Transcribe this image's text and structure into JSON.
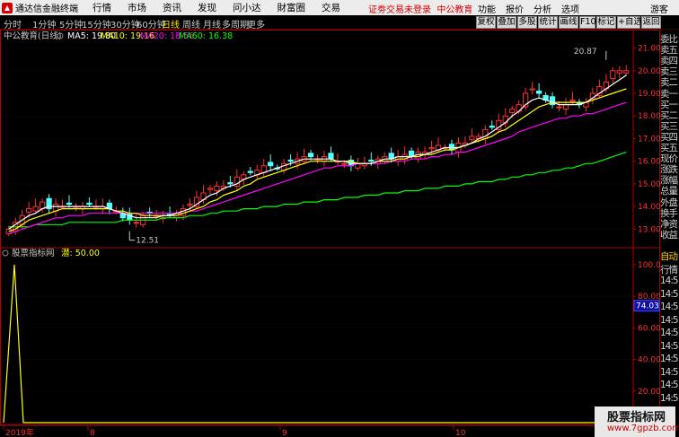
{
  "menubar": {
    "app_name": "通达信金融终端",
    "items": [
      "行情",
      "市场",
      "资讯",
      "发现",
      "问小达",
      "財富圈",
      "交易"
    ],
    "notice": "证劵交易未登录",
    "stock": "中公教育",
    "right_items": [
      "功能",
      "报价",
      "分析",
      "选项"
    ],
    "user": "游客"
  },
  "toolbar": {
    "periods": [
      "分时",
      "1分钟",
      "5分钟",
      "15分钟",
      "30分钟",
      "60分钟",
      "日线",
      "周线",
      "月线",
      "多周期",
      "更多"
    ],
    "active_period": "日线",
    "tools": [
      "复权",
      "叠加",
      "多股",
      "统计",
      "画线",
      "F10",
      "标记",
      "+自选",
      "返回"
    ]
  },
  "price_panel": {
    "title": "中公教育(日线)",
    "ma_items": [
      {
        "label": "MA5: 19.80",
        "color": "#ffffff"
      },
      {
        "label": "MA10: 19.16",
        "color": "#ffff00"
      },
      {
        "label": "MA20: 18.56",
        "color": "#ff00ff"
      },
      {
        "label": "MA60: 16.38",
        "color": "#00ff00"
      }
    ],
    "high_annotation": "20.87",
    "low_annotation": "12.51",
    "y_ticks": [
      "21.00",
      "20.00",
      "19.00",
      "18.00",
      "17.00",
      "16.00",
      "15.00",
      "14.00",
      "13.00"
    ]
  },
  "indicator_panel": {
    "title": "股票指标网",
    "label": "潜: 50.00",
    "y_ticks": [
      "100.0",
      "80.00",
      "60.00",
      "40.00",
      "20.00",
      "0.00"
    ],
    "current_value": "74.03"
  },
  "x_axis": {
    "labels": [
      "2019年",
      "8",
      "9",
      "10"
    ]
  },
  "sidepanel": {
    "labels": [
      "委比",
      "卖五",
      "卖四",
      "卖三",
      "卖二",
      "卖一",
      "买一",
      "买二",
      "买三",
      "买四",
      "买五",
      "现价",
      "涨跌",
      "涨幅",
      "总量",
      "外盘",
      "换手",
      "净资",
      "收益"
    ],
    "labels2": [
      "自动",
      "行情",
      "14:5",
      "14:5",
      "14:5",
      "14:5",
      "14:5",
      "14:5",
      "14:5",
      "14:5",
      "14:5",
      "14:5"
    ]
  },
  "watermark": {
    "title": "股票指标网",
    "url": "www.7gpzb.com"
  },
  "colors": {
    "up": "#ff3030",
    "down": "#54ffff",
    "ma5": "#ffffff",
    "ma10": "#ffff00",
    "ma20": "#ff00ff",
    "ma60": "#00ff00",
    "frame": "#b00000",
    "axis_text": "#ff3030"
  },
  "chart_data": {
    "type": "line",
    "y_range_price": [
      12.3,
      21.3
    ],
    "candles_close": [
      13.0,
      13.3,
      13.6,
      13.9,
      14.0,
      14.2,
      13.9,
      14.1,
      14.0,
      14.1,
      14.0,
      14.0,
      14.1,
      14.0,
      14.0,
      13.9,
      13.8,
      13.5,
      13.4,
      13.3,
      13.6,
      13.7,
      13.6,
      13.5,
      13.6,
      13.7,
      13.9,
      14.1,
      14.4,
      14.6,
      14.8,
      14.9,
      14.9,
      15.0,
      15.3,
      15.4,
      15.5,
      15.6,
      15.8,
      15.8,
      15.7,
      15.9,
      16.0,
      16.1,
      16.2,
      16.2,
      16.1,
      16.2,
      16.1,
      16.0,
      15.9,
      15.8,
      15.9,
      15.9,
      16.0,
      16.1,
      16.2,
      16.1,
      16.2,
      16.3,
      16.2,
      16.4,
      16.4,
      16.6,
      16.7,
      16.6,
      16.5,
      16.8,
      16.8,
      17.1,
      17.1,
      17.4,
      17.5,
      17.8,
      18.0,
      18.3,
      18.5,
      19.0,
      19.2,
      19.0,
      18.7,
      18.5,
      18.4,
      18.5,
      18.7,
      18.5,
      18.6,
      19.0,
      19.3,
      19.5,
      20.0,
      20.0,
      20.0
    ],
    "ma5": [
      13.0,
      13.2,
      13.4,
      13.6,
      13.7,
      13.9,
      14.0,
      14.0,
      14.0,
      14.0,
      14.0,
      14.0,
      14.0,
      14.0,
      14.0,
      13.9,
      13.8,
      13.7,
      13.6,
      13.5,
      13.5,
      13.5,
      13.5,
      13.6,
      13.6,
      13.7,
      13.8,
      13.9,
      14.1,
      14.3,
      14.5,
      14.6,
      14.8,
      14.9,
      15.0,
      15.2,
      15.3,
      15.4,
      15.5,
      15.6,
      15.7,
      15.8,
      15.9,
      16.0,
      16.1,
      16.1,
      16.1,
      16.1,
      16.1,
      16.0,
      16.0,
      15.9,
      15.9,
      15.9,
      15.9,
      16.0,
      16.1,
      16.1,
      16.2,
      16.2,
      16.2,
      16.3,
      16.3,
      16.4,
      16.5,
      16.6,
      16.6,
      16.6,
      16.7,
      16.8,
      17.0,
      17.1,
      17.3,
      17.5,
      17.7,
      18.0,
      18.2,
      18.5,
      18.7,
      18.8,
      18.7,
      18.6,
      18.5,
      18.5,
      18.5,
      18.5,
      18.6,
      18.8,
      19.0,
      19.2,
      19.4,
      19.6,
      19.8
    ],
    "ma10": [
      12.9,
      13.0,
      13.2,
      13.4,
      13.5,
      13.6,
      13.7,
      13.8,
      13.9,
      13.9,
      13.9,
      13.9,
      13.9,
      13.9,
      13.9,
      13.9,
      13.8,
      13.8,
      13.7,
      13.7,
      13.6,
      13.6,
      13.6,
      13.6,
      13.6,
      13.6,
      13.7,
      13.8,
      13.9,
      14.0,
      14.2,
      14.3,
      14.5,
      14.6,
      14.7,
      14.9,
      15.0,
      15.2,
      15.3,
      15.4,
      15.5,
      15.6,
      15.7,
      15.8,
      15.9,
      16.0,
      16.0,
      16.0,
      16.0,
      16.0,
      16.0,
      16.0,
      15.9,
      15.9,
      15.9,
      16.0,
      16.0,
      16.0,
      16.1,
      16.1,
      16.2,
      16.2,
      16.3,
      16.3,
      16.4,
      16.5,
      16.5,
      16.6,
      16.7,
      16.8,
      16.9,
      17.0,
      17.1,
      17.3,
      17.4,
      17.6,
      17.8,
      18.0,
      18.2,
      18.4,
      18.5,
      18.6,
      18.6,
      18.6,
      18.6,
      18.6,
      18.6,
      18.7,
      18.8,
      18.9,
      19.0,
      19.1,
      19.2
    ],
    "ma20": [
      12.8,
      12.9,
      13.0,
      13.1,
      13.2,
      13.3,
      13.4,
      13.5,
      13.5,
      13.6,
      13.6,
      13.6,
      13.7,
      13.7,
      13.7,
      13.7,
      13.7,
      13.7,
      13.7,
      13.7,
      13.7,
      13.7,
      13.7,
      13.7,
      13.7,
      13.7,
      13.7,
      13.8,
      13.8,
      13.9,
      14.0,
      14.1,
      14.2,
      14.3,
      14.4,
      14.5,
      14.6,
      14.7,
      14.8,
      14.9,
      15.0,
      15.1,
      15.2,
      15.3,
      15.4,
      15.5,
      15.6,
      15.7,
      15.7,
      15.8,
      15.8,
      15.8,
      15.9,
      15.9,
      15.9,
      15.9,
      15.9,
      16.0,
      16.0,
      16.0,
      16.1,
      16.1,
      16.1,
      16.2,
      16.2,
      16.3,
      16.3,
      16.4,
      16.4,
      16.5,
      16.6,
      16.7,
      16.8,
      16.9,
      17.0,
      17.1,
      17.3,
      17.4,
      17.5,
      17.6,
      17.7,
      17.8,
      17.9,
      17.9,
      18.0,
      18.0,
      18.1,
      18.1,
      18.2,
      18.3,
      18.4,
      18.5,
      18.6
    ],
    "ma60": [
      13.1,
      13.1,
      13.1,
      13.1,
      13.2,
      13.2,
      13.2,
      13.2,
      13.2,
      13.3,
      13.3,
      13.3,
      13.3,
      13.3,
      13.3,
      13.3,
      13.3,
      13.4,
      13.4,
      13.4,
      13.4,
      13.4,
      13.4,
      13.5,
      13.5,
      13.5,
      13.5,
      13.6,
      13.6,
      13.6,
      13.7,
      13.7,
      13.8,
      13.8,
      13.8,
      13.9,
      13.9,
      13.9,
      14.0,
      14.0,
      14.0,
      14.1,
      14.1,
      14.1,
      14.2,
      14.2,
      14.2,
      14.3,
      14.3,
      14.3,
      14.4,
      14.4,
      14.4,
      14.5,
      14.5,
      14.5,
      14.6,
      14.6,
      14.6,
      14.7,
      14.7,
      14.7,
      14.8,
      14.8,
      14.8,
      14.9,
      14.9,
      14.9,
      15.0,
      15.0,
      15.1,
      15.1,
      15.1,
      15.2,
      15.2,
      15.3,
      15.3,
      15.4,
      15.4,
      15.5,
      15.5,
      15.6,
      15.6,
      15.7,
      15.7,
      15.8,
      15.9,
      15.9,
      16.0,
      16.1,
      16.2,
      16.3,
      16.4
    ],
    "indicator_values": [
      0,
      0,
      100,
      0,
      0,
      0,
      0,
      0,
      0,
      0,
      0,
      0,
      0,
      0,
      0,
      0,
      0,
      0,
      0,
      0,
      0,
      0,
      0,
      0,
      0,
      0,
      0,
      0,
      0,
      0,
      0,
      0,
      0,
      0,
      0,
      0,
      0,
      0,
      0,
      0,
      0,
      0,
      0,
      0,
      0,
      0,
      0,
      0,
      0,
      0,
      0,
      0,
      0,
      0,
      0,
      0,
      0,
      0,
      0,
      0,
      0,
      0,
      0,
      0,
      0,
      0,
      0,
      0,
      0,
      0,
      0,
      0,
      0,
      0,
      0,
      0,
      0,
      0,
      0,
      0,
      0,
      0,
      0,
      0,
      0,
      0,
      0,
      0,
      0,
      0,
      0,
      0,
      0
    ]
  }
}
